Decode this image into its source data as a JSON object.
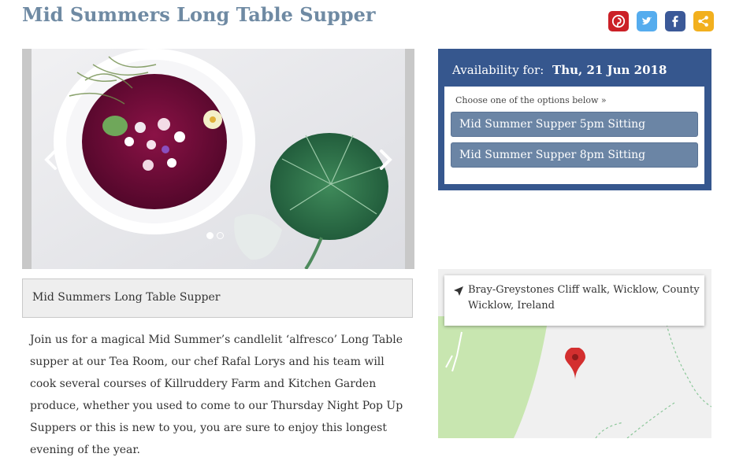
{
  "page": {
    "title": "Mid Summers Long Table Supper"
  },
  "share": [
    {
      "name": "pinterest",
      "color": "#cb2027"
    },
    {
      "name": "twitter",
      "color": "#55acee"
    },
    {
      "name": "facebook",
      "color": "#3b5998"
    },
    {
      "name": "share",
      "color": "#f2b01e"
    }
  ],
  "carousel": {
    "image_subject": "beetroot soup bowl with nasturtium leaf",
    "slides_total": 2,
    "active_slide": 1
  },
  "caption": "Mid Summers Long Table Supper",
  "description": "Join us for a magical Mid Summer’s candlelit ‘alfresco’ Long Table supper at our Tea Room, our chef Rafal Lorys and his team will cook several courses of Killruddery Farm and Kitchen Garden produce, whether you used to come to our Thursday Night Pop Up Suppers or this is new to you, you are sure to enjoy this longest evening of the year.",
  "availability": {
    "label": "Availability for:",
    "date": "Thu, 21 Jun 2018",
    "choose_text": "Choose one of the options below »",
    "options": [
      "Mid Summer Supper 5pm Sitting",
      "Mid Summer Supper 8pm Sitting"
    ]
  },
  "map": {
    "address": "Bray-Greystones Cliff walk, Wicklow, County Wicklow, Ireland",
    "pin_color": "#d32f2f",
    "land_color": "#c8e6b0"
  }
}
